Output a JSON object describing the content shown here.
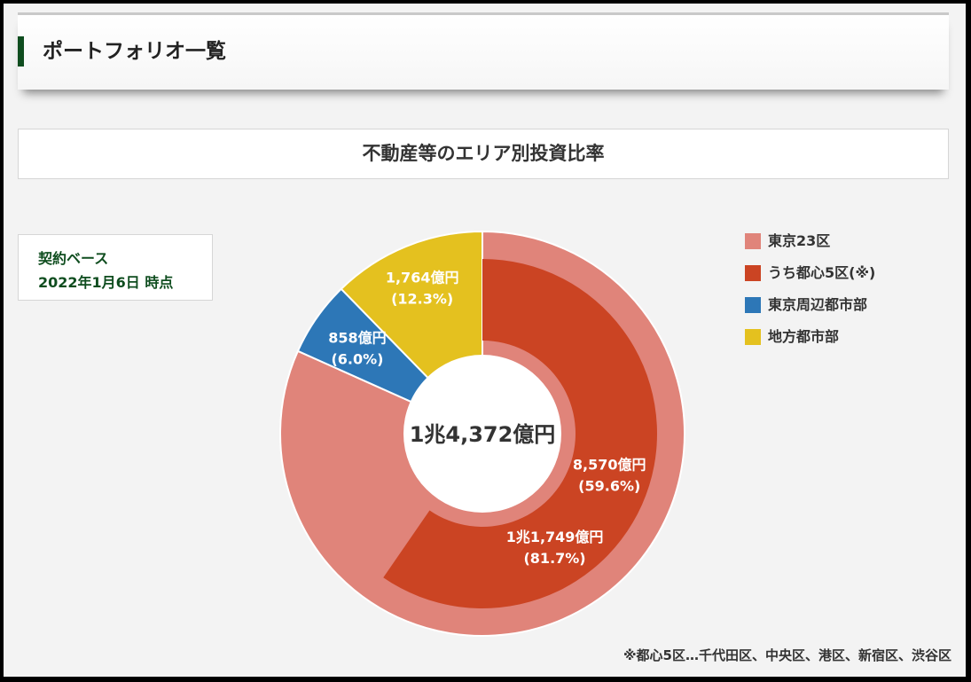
{
  "header": {
    "title": "ポートフォリオ一覧"
  },
  "basis": {
    "line1": "契約ベース",
    "line2": "2022年1月6日 時点"
  },
  "colors": {
    "tokyo23": "#e0847a",
    "central5": "#cb4423",
    "suburbs": "#2d77b7",
    "regional": "#e4c11f"
  },
  "chart_data": {
    "type": "pie",
    "title": "不動産等のエリア別投資比率",
    "center_label": "1兆4,372億円",
    "outer_ring": [
      {
        "name": "東京23区",
        "value": 81.7,
        "amount": "1兆1,749億円",
        "percent": "(81.7%)",
        "color": "#e0847a"
      },
      {
        "name": "東京周辺都市部",
        "value": 6.0,
        "amount": "858億円",
        "percent": "(6.0%)",
        "color": "#2d77b7"
      },
      {
        "name": "地方都市部",
        "value": 12.3,
        "amount": "1,764億円",
        "percent": "(12.3%)",
        "color": "#e4c11f"
      }
    ],
    "inner_ring": [
      {
        "name": "うち都心5区(※)",
        "value": 59.6,
        "amount": "8,570億円",
        "percent": "(59.6%)",
        "color": "#cb4423"
      }
    ],
    "legend": [
      {
        "label": "東京23区",
        "color": "#e0847a"
      },
      {
        "label": "うち都心5区(※)",
        "color": "#cb4423"
      },
      {
        "label": "東京周辺都市部",
        "color": "#2d77b7"
      },
      {
        "label": "地方都市部",
        "color": "#e4c11f"
      }
    ],
    "legend_position": "top-right",
    "footnote": "※都心5区…千代田区、中央区、港区、新宿区、渋谷区"
  }
}
